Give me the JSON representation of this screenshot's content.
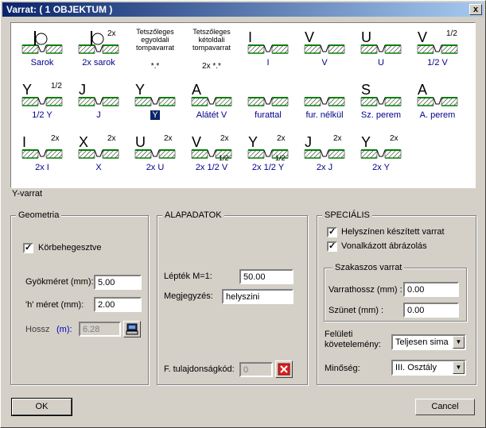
{
  "window": {
    "title": "Varrat: ( 1 OBJEKTUM )",
    "close": "x"
  },
  "palette": {
    "row1": [
      {
        "label": "Sarok",
        "type": "label"
      },
      {
        "label": "2x sarok",
        "type": "label",
        "tag": "2x"
      },
      {
        "label": "*.*",
        "type": "text",
        "title": "Tetszőleges egyoldali tompavarrat"
      },
      {
        "label": "2x *.*",
        "type": "text",
        "title": "Tetszőleges kétoldali tompavarrat"
      },
      {
        "label": "I",
        "type": "label"
      },
      {
        "label": "V",
        "type": "label"
      },
      {
        "label": "U",
        "type": "label"
      },
      {
        "label": "1/2 V",
        "type": "label",
        "tag": "1/2"
      }
    ],
    "row2": [
      {
        "label": "1/2 Y",
        "type": "label",
        "tag": "1/2"
      },
      {
        "label": "J",
        "type": "label"
      },
      {
        "label": "Y",
        "type": "label",
        "selected": true
      },
      {
        "label": "Alátét V",
        "type": "label"
      },
      {
        "label": "furattal",
        "type": "label"
      },
      {
        "label": "fur. nélkül",
        "type": "label"
      },
      {
        "label": "Sz. perem",
        "type": "label"
      },
      {
        "label": "A. perem",
        "type": "label"
      }
    ],
    "row3": [
      {
        "label": "2x I",
        "type": "label",
        "tag": "2x"
      },
      {
        "label": "X",
        "type": "label",
        "tag": "2x"
      },
      {
        "label": "2x U",
        "type": "label",
        "tag": "2x"
      },
      {
        "label": "2x 1/2 V",
        "type": "label",
        "tag": "2x",
        "tag2": "1/2"
      },
      {
        "label": "2x 1/2 Y",
        "type": "label",
        "tag": "2x",
        "tag2": "1/2"
      },
      {
        "label": "2x J",
        "type": "label",
        "tag": "2x"
      },
      {
        "label": "2x Y",
        "type": "label",
        "tag": "2x"
      }
    ]
  },
  "selected_name": "Y-varrat",
  "geometria": {
    "title": "Geometria",
    "korbe_label": "Körbehegesztve",
    "korbe_checked": "✓",
    "gyok_label": "Gyökméret (mm):",
    "gyok_value": "5.00",
    "h_label": "'h' méret (mm):",
    "h_value": "2.00",
    "hossz_label": "Hossz",
    "hossz_unit": "(m):",
    "hossz_value": "6.28"
  },
  "alapadatok": {
    "title": "ALAPADATOK",
    "leptek_label": "Lépték M=1:",
    "leptek_value": "50.00",
    "megj_label": "Megjegyzés:",
    "megj_value": "helyszini",
    "ftul_label": "F. tulajdonságkód:",
    "ftul_value": "0"
  },
  "specialis": {
    "title": "SPECIÁLIS",
    "helyszinen_label": "Helyszínen készített varrat",
    "helyszinen_checked": "✓",
    "vonal_label": "Vonalkázott ábrázolás",
    "vonal_checked": "✓",
    "szakaszos_title": "Szakaszos varrat",
    "varrathossz_label": "Varrathossz (mm) :",
    "varrathossz_value": "0.00",
    "szunet_label": "Szünet (mm) :",
    "szunet_value": "0.00",
    "feluleti_label1": "Felületi",
    "feluleti_label2": "követelemény:",
    "feluleti_value": "Teljesen sima",
    "minoseg_label": "Minőség:",
    "minoseg_value": "III. Osztály"
  },
  "buttons": {
    "ok": "OK",
    "cancel": "Cancel"
  }
}
